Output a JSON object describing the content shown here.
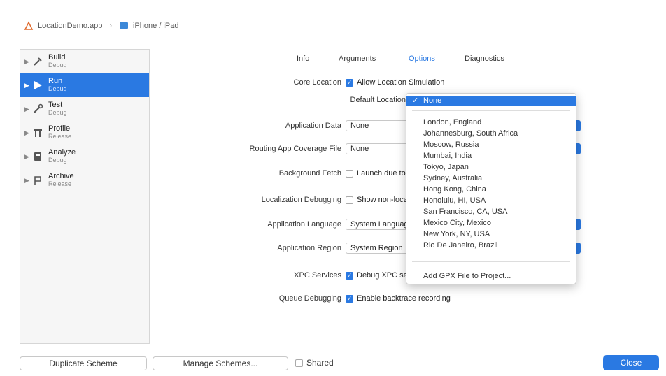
{
  "breadcrumb": {
    "project": "LocationDemo.app",
    "device": "iPhone / iPad"
  },
  "sidebar": {
    "items": [
      {
        "title": "Build",
        "subtitle": "Debug",
        "icon": "hammer-icon",
        "selected": false
      },
      {
        "title": "Run",
        "subtitle": "Debug",
        "icon": "play-icon",
        "selected": true
      },
      {
        "title": "Test",
        "subtitle": "Debug",
        "icon": "wrench-icon",
        "selected": false
      },
      {
        "title": "Profile",
        "subtitle": "Release",
        "icon": "gauge-icon",
        "selected": false
      },
      {
        "title": "Analyze",
        "subtitle": "Debug",
        "icon": "analyze-icon",
        "selected": false
      },
      {
        "title": "Archive",
        "subtitle": "Release",
        "icon": "archive-icon",
        "selected": false
      }
    ]
  },
  "tabs": [
    {
      "label": "Info",
      "active": false
    },
    {
      "label": "Arguments",
      "active": false
    },
    {
      "label": "Options",
      "active": true
    },
    {
      "label": "Diagnostics",
      "active": false
    }
  ],
  "options": {
    "core_location_label": "Core Location",
    "allow_location_sim": "Allow Location Simulation",
    "default_location_label": "Default Location",
    "app_data_label": "Application Data",
    "app_data_value": "None",
    "code_coverage_label": "Routing App Coverage File",
    "code_coverage_value": "None",
    "background_fetch_label": "Background Fetch",
    "background_fetch_value": "Launch due to a background fetch event",
    "localization_label": "Localization Debugging",
    "localization_value": "Show non-localized strings",
    "app_language_label": "Application Language",
    "app_language_value": "System Language",
    "app_region_label": "Application Region",
    "app_region_value": "System Region",
    "xpc_label": "XPC Services",
    "xpc_value": "Debug XPC services",
    "queue_label": "Queue Debugging",
    "queue_value": "Enable backtrace recording"
  },
  "location_popup": {
    "selected": "None",
    "items": [
      "London, England",
      "Johannesburg, South Africa",
      "Moscow, Russia",
      "Mumbai, India",
      "Tokyo, Japan",
      "Sydney, Australia",
      "Hong Kong, China",
      "Honolulu, HI, USA",
      "San Francisco, CA, USA",
      "Mexico City, Mexico",
      "New York, NY, USA",
      "Rio De Janeiro, Brazil"
    ],
    "add_item": "Add GPX File to Project..."
  },
  "footer": {
    "duplicate": "Duplicate Scheme",
    "manage": "Manage Schemes...",
    "shared": "Shared",
    "close": "Close"
  },
  "colors": {
    "accent": "#2a79e2"
  }
}
